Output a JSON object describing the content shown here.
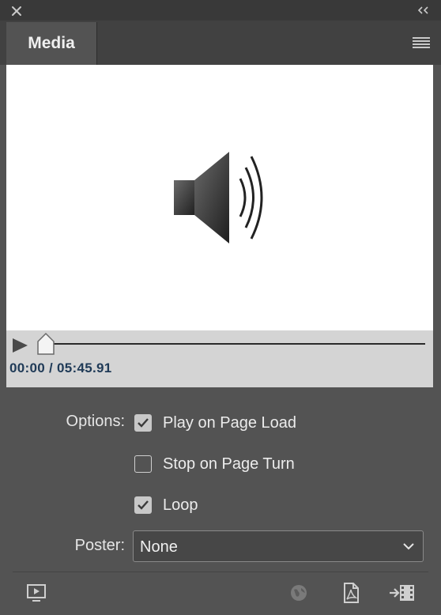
{
  "panel": {
    "tab_label": "Media"
  },
  "transport": {
    "time_readout": "00:00 / 05:45.91",
    "position_fraction": 0.0
  },
  "options": {
    "label": "Options:",
    "items": [
      {
        "label": "Play on Page Load",
        "checked": true
      },
      {
        "label": "Stop on Page Turn",
        "checked": false
      },
      {
        "label": "Loop",
        "checked": true
      }
    ]
  },
  "poster": {
    "label": "Poster:",
    "value": "None"
  },
  "footer": {
    "icons": [
      "preview-icon",
      "globe-icon",
      "pdf-icon",
      "export-video-icon"
    ]
  },
  "colors": {
    "panel_bg": "#535353",
    "preview_bg": "#ffffff",
    "transport_bg": "#d4d4d4",
    "time_text": "#1f3a57"
  }
}
